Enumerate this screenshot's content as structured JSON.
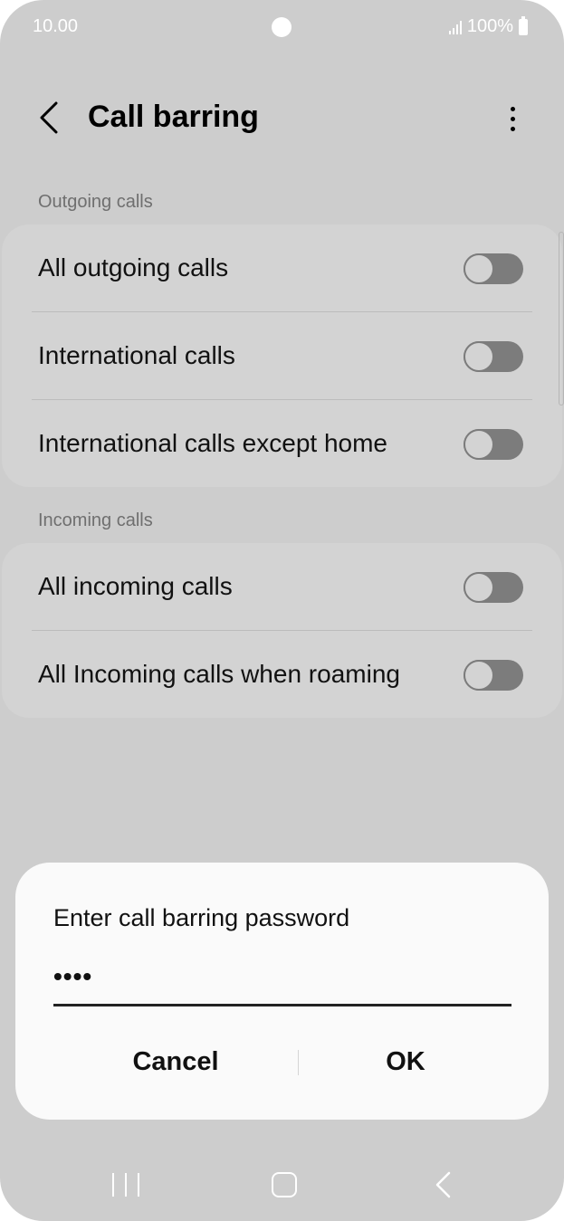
{
  "status_bar": {
    "time": "10.00",
    "battery": "100%"
  },
  "header": {
    "title": "Call barring"
  },
  "sections": {
    "outgoing": {
      "label": "Outgoing calls",
      "items": [
        {
          "label": "All outgoing calls",
          "enabled": false
        },
        {
          "label": "International calls",
          "enabled": false
        },
        {
          "label": "International calls except home",
          "enabled": false
        }
      ]
    },
    "incoming": {
      "label": "Incoming calls",
      "items": [
        {
          "label": "All incoming calls",
          "enabled": false
        },
        {
          "label": "All Incoming calls when roaming",
          "enabled": false
        }
      ]
    }
  },
  "dialog": {
    "title": "Enter call barring password",
    "password_value": "••••",
    "cancel_label": "Cancel",
    "ok_label": "OK"
  },
  "icons": {
    "back": "back-arrow-icon",
    "more": "more-vertical-icon",
    "nav_recent": "recent-apps-icon",
    "nav_home": "home-icon",
    "nav_back": "nav-back-icon"
  },
  "colors": {
    "background_dimmed": "#cdcdcd",
    "card": "#d3d3d3",
    "dialog": "#fafafa",
    "toggle_off": "#7c7c7c"
  }
}
